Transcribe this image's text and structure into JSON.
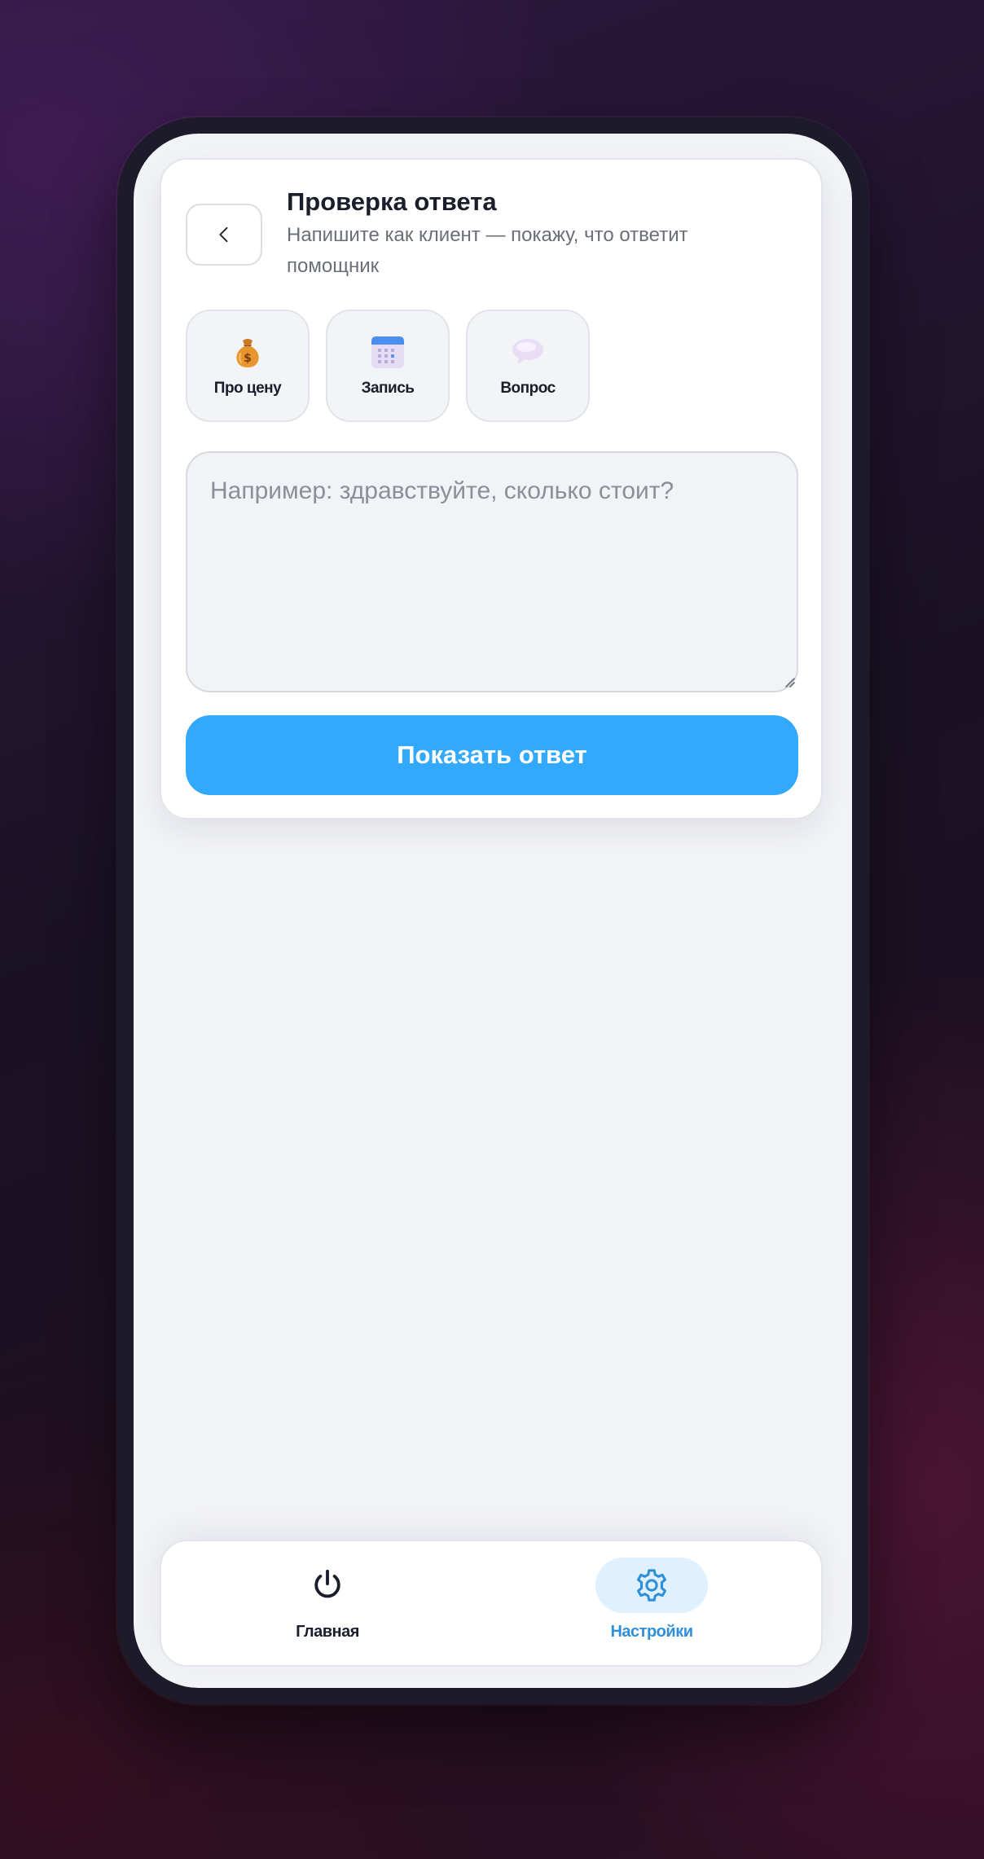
{
  "header": {
    "title": "Проверка ответа",
    "subtitle": "Напишите как клиент — покажу, что ответит помощник"
  },
  "chips": [
    {
      "label": "Про цену",
      "icon": "money-bag-icon"
    },
    {
      "label": "Запись",
      "icon": "calendar-icon"
    },
    {
      "label": "Вопрос",
      "icon": "speech-bubble-icon"
    }
  ],
  "message_input": {
    "value": "",
    "placeholder": "Например: здравствуйте, сколько стоит?"
  },
  "submit": {
    "label": "Показать ответ"
  },
  "bottom_nav": {
    "items": [
      {
        "label": "Главная",
        "icon": "power-icon",
        "active": false
      },
      {
        "label": "Настройки",
        "icon": "gear-icon",
        "active": true
      }
    ]
  },
  "colors": {
    "accent": "#33a9fd",
    "active_nav": "#2f8fd8",
    "active_nav_bg": "#dff0ff",
    "text": "#1a1e2b",
    "muted_text": "#6a6e78",
    "screen_bg": "#f2f3f7"
  }
}
